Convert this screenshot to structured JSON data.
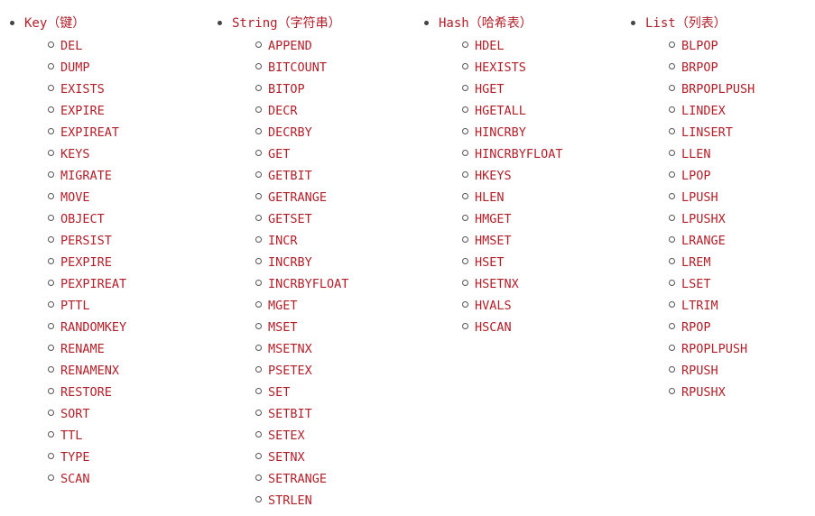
{
  "groups": [
    {
      "title": "Key（键）",
      "commands": [
        "DEL",
        "DUMP",
        "EXISTS",
        "EXPIRE",
        "EXPIREAT",
        "KEYS",
        "MIGRATE",
        "MOVE",
        "OBJECT",
        "PERSIST",
        "PEXPIRE",
        "PEXPIREAT",
        "PTTL",
        "RANDOMKEY",
        "RENAME",
        "RENAMENX",
        "RESTORE",
        "SORT",
        "TTL",
        "TYPE",
        "SCAN"
      ]
    },
    {
      "title": "String（字符串）",
      "commands": [
        "APPEND",
        "BITCOUNT",
        "BITOP",
        "DECR",
        "DECRBY",
        "GET",
        "GETBIT",
        "GETRANGE",
        "GETSET",
        "INCR",
        "INCRBY",
        "INCRBYFLOAT",
        "MGET",
        "MSET",
        "MSETNX",
        "PSETEX",
        "SET",
        "SETBIT",
        "SETEX",
        "SETNX",
        "SETRANGE",
        "STRLEN"
      ]
    },
    {
      "title": "Hash（哈希表）",
      "commands": [
        "HDEL",
        "HEXISTS",
        "HGET",
        "HGETALL",
        "HINCRBY",
        "HINCRBYFLOAT",
        "HKEYS",
        "HLEN",
        "HMGET",
        "HMSET",
        "HSET",
        "HSETNX",
        "HVALS",
        "HSCAN"
      ]
    },
    {
      "title": "List（列表）",
      "commands": [
        "BLPOP",
        "BRPOP",
        "BRPOPLPUSH",
        "LINDEX",
        "LINSERT",
        "LLEN",
        "LPOP",
        "LPUSH",
        "LPUSHX",
        "LRANGE",
        "LREM",
        "LSET",
        "LTRIM",
        "RPOP",
        "RPOPLPUSH",
        "RPUSH",
        "RPUSHX"
      ]
    }
  ],
  "colors": {
    "link": "#b0202a",
    "bullet": "#444444"
  }
}
